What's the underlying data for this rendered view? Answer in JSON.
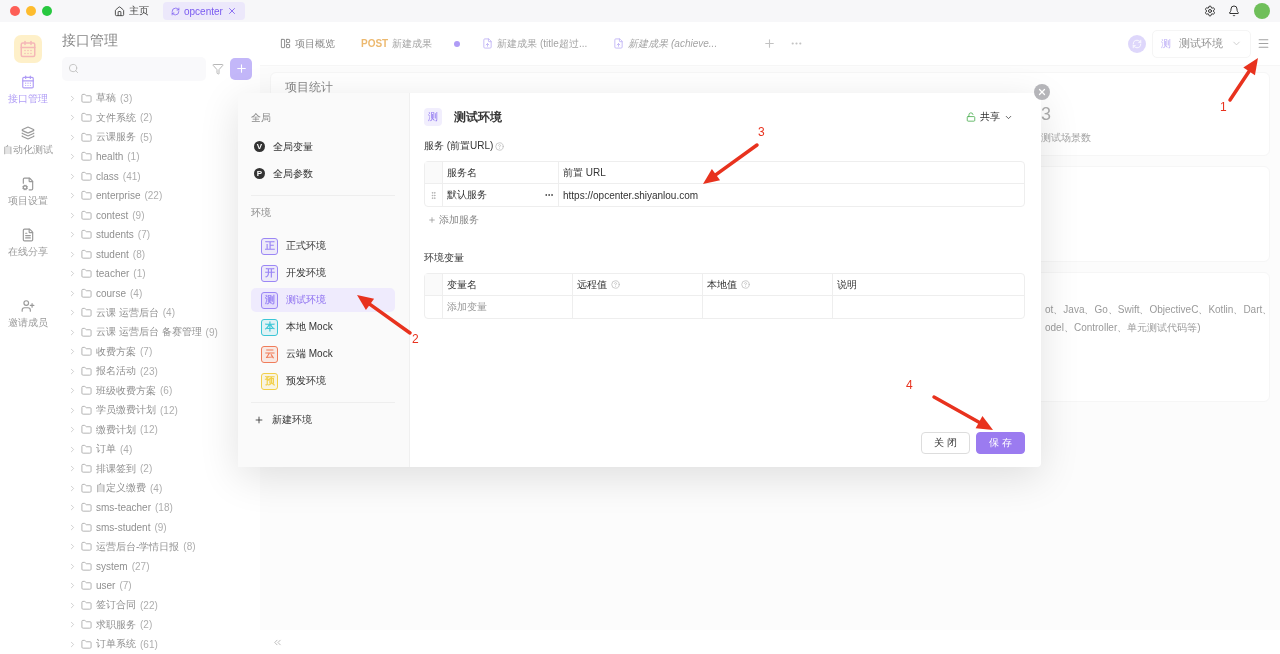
{
  "titlebar": {
    "tabs": [
      {
        "label": "主页",
        "kind": "home",
        "selected": false,
        "closable": false
      },
      {
        "label": "opcenter",
        "kind": "project",
        "selected": true,
        "closable": true
      }
    ]
  },
  "rail": {
    "items": [
      {
        "label": "接口管理",
        "kind": "api",
        "selected": true
      },
      {
        "label": "自动化测试",
        "kind": "auto",
        "selected": false
      },
      {
        "label": "项目设置",
        "kind": "settings",
        "selected": false
      },
      {
        "label": "在线分享",
        "kind": "share",
        "selected": false
      },
      {
        "label": "邀请成员",
        "kind": "invite",
        "selected": false
      }
    ]
  },
  "tree": {
    "title": "接口管理",
    "items": [
      {
        "name": "草稿",
        "count": "(3)"
      },
      {
        "name": "文件系统",
        "count": "(2)"
      },
      {
        "name": "云课服务",
        "count": "(5)"
      },
      {
        "name": "health",
        "count": "(1)"
      },
      {
        "name": "class",
        "count": "(41)"
      },
      {
        "name": "enterprise",
        "count": "(22)"
      },
      {
        "name": "contest",
        "count": "(9)"
      },
      {
        "name": "students",
        "count": "(7)"
      },
      {
        "name": "student",
        "count": "(8)"
      },
      {
        "name": "teacher",
        "count": "(1)"
      },
      {
        "name": "course",
        "count": "(4)"
      },
      {
        "name": "云课 运营后台",
        "count": "(4)"
      },
      {
        "name": "云课 运营后台 备赛管理",
        "count": "(9)"
      },
      {
        "name": "收费方案",
        "count": "(7)"
      },
      {
        "name": "报名活动",
        "count": "(23)"
      },
      {
        "name": "班级收费方案",
        "count": "(6)"
      },
      {
        "name": "学员缴费计划",
        "count": "(12)"
      },
      {
        "name": "缴费计划",
        "count": "(12)"
      },
      {
        "name": "订单",
        "count": "(4)"
      },
      {
        "name": "排课签到",
        "count": "(2)"
      },
      {
        "name": "自定义缴费",
        "count": "(4)"
      },
      {
        "name": "sms-teacher",
        "count": "(18)"
      },
      {
        "name": "sms-student",
        "count": "(9)"
      },
      {
        "name": "运营后台-学情日报",
        "count": "(8)"
      },
      {
        "name": "system",
        "count": "(27)"
      },
      {
        "name": "user",
        "count": "(7)"
      },
      {
        "name": "签订合同",
        "count": "(22)"
      },
      {
        "name": "求职服务",
        "count": "(2)"
      },
      {
        "name": "订单系统",
        "count": "(61)"
      }
    ]
  },
  "doc_tabs": [
    {
      "label": "项目概览",
      "kind": "overview",
      "selected": true,
      "preview": false,
      "unsaved": false
    },
    {
      "method": "POST",
      "label": "新建成果",
      "kind": "request",
      "selected": false,
      "preview": false,
      "unsaved": true
    },
    {
      "label": "新建成果 (title超过...",
      "kind": "upload",
      "selected": false,
      "preview": false,
      "unsaved": false
    },
    {
      "label": "新建成果 (achieve...",
      "kind": "upload",
      "selected": false,
      "preview": true,
      "unsaved": false
    }
  ],
  "env_select": {
    "badge": "测",
    "label": "测试环境"
  },
  "overview": {
    "title": "项目统计",
    "stat": {
      "value": "3",
      "label": "测试场景数"
    },
    "lines": [
      "ot、Java、Go、Swift、ObjectiveC、Kotlin、Dart、",
      "odel、Controller、单元测试代码等)"
    ]
  },
  "modal": {
    "sidebar": {
      "global_heading": "全局",
      "global_items": [
        {
          "letter": "V",
          "label": "全局变量"
        },
        {
          "letter": "P",
          "label": "全局参数"
        }
      ],
      "env_heading": "环境",
      "environments": [
        {
          "badge": "正",
          "label": "正式环境",
          "color": "#9b87f5",
          "selected": false
        },
        {
          "badge": "开",
          "label": "开发环境",
          "color": "#9b87f5",
          "selected": false
        },
        {
          "badge": "测",
          "label": "测试环境",
          "color": "#9b87f5",
          "selected": true
        },
        {
          "badge": "本",
          "label": "本地 Mock",
          "color": "#3cc6d6",
          "selected": false
        },
        {
          "badge": "云",
          "label": "云端 Mock",
          "color": "#f07c5a",
          "selected": false
        },
        {
          "badge": "预",
          "label": "预发环境",
          "color": "#f2cf4a",
          "selected": false
        }
      ],
      "new_env": "新建环境"
    },
    "header": {
      "badge": "测",
      "title": "测试环境",
      "share": "共享"
    },
    "services": {
      "heading": "服务 (前置URL)",
      "columns": [
        "服务名",
        "前置 URL"
      ],
      "rows": [
        {
          "name": "默认服务",
          "url": "https://opcenter.shiyanlou.com"
        }
      ],
      "add": "添加服务"
    },
    "variables": {
      "heading": "环境变量",
      "columns": [
        {
          "label": "变量名",
          "help": false
        },
        {
          "label": "远程值",
          "help": true
        },
        {
          "label": "本地值",
          "help": true
        },
        {
          "label": "说明",
          "help": false
        }
      ],
      "placeholder": "添加变量"
    },
    "buttons": [
      {
        "label": "关 闭",
        "kind": "secondary"
      },
      {
        "label": "保 存",
        "kind": "primary"
      }
    ]
  },
  "annotations": [
    {
      "label": "1"
    },
    {
      "label": "2"
    },
    {
      "label": "3"
    },
    {
      "label": "4"
    }
  ]
}
